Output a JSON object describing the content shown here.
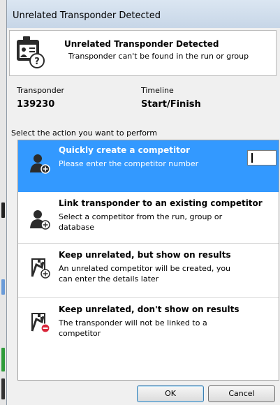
{
  "window": {
    "title": "Unrelated Transponder Detected",
    "background_title": ""
  },
  "header": {
    "icon": "badge-question-icon",
    "title": "Unrelated Transponder Detected",
    "subtitle": "Transponder can't be found in the run or group"
  },
  "info": {
    "transponder_label": "Transponder",
    "transponder_value": "139230",
    "timeline_label": "Timeline",
    "timeline_value": "Start/Finish"
  },
  "prompt": "Select the action you want to perform",
  "options": [
    {
      "icon": "person-add-icon",
      "title": "Quickly create a competitor",
      "desc": "Please enter the competitor number",
      "selected": true
    },
    {
      "icon": "person-link-icon",
      "title": "Link transponder to an existing competitor",
      "desc": "Select a competitor from the run, group or database",
      "selected": false
    },
    {
      "icon": "flag-add-icon",
      "title": "Keep unrelated, but show on results",
      "desc": "An unrelated competitor will be created, you can enter the details later",
      "selected": false
    },
    {
      "icon": "flag-remove-icon",
      "title": "Keep unrelated, don't show on results",
      "desc": "The transponder will not be linked to a competitor",
      "selected": false
    }
  ],
  "competitor_number": {
    "value": ""
  },
  "buttons": {
    "ok": "OK",
    "cancel": "Cancel"
  },
  "colors": {
    "selection": "#3399ff",
    "add_badge": "#333333",
    "remove_badge": "#d9263a"
  }
}
